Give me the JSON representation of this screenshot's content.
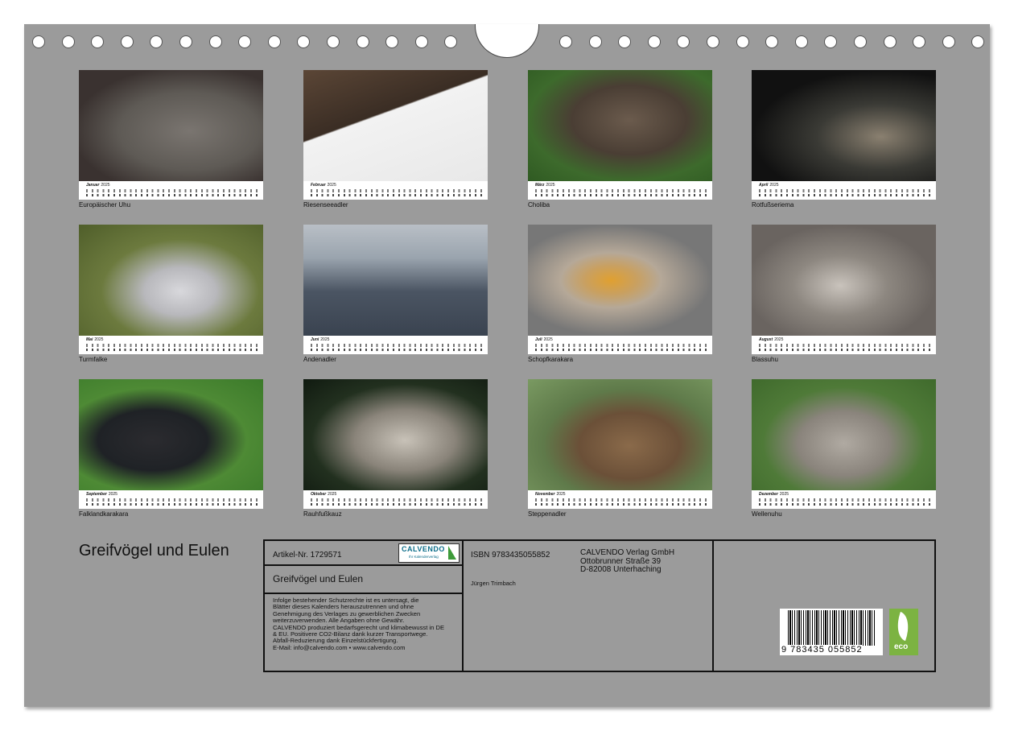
{
  "months": [
    {
      "month": "Januar",
      "year": "2025",
      "caption": "Europäischer Uhu"
    },
    {
      "month": "Februar",
      "year": "2025",
      "caption": "Riesenseeadler"
    },
    {
      "month": "März",
      "year": "2025",
      "caption": "Choliba"
    },
    {
      "month": "April",
      "year": "2025",
      "caption": "Rotfußseriema"
    },
    {
      "month": "Mai",
      "year": "2025",
      "caption": "Turmfalke"
    },
    {
      "month": "Juni",
      "year": "2025",
      "caption": "Andenadler"
    },
    {
      "month": "Juli",
      "year": "2025",
      "caption": "Schopfkarakara"
    },
    {
      "month": "August",
      "year": "2025",
      "caption": "Blassuhu"
    },
    {
      "month": "September",
      "year": "2025",
      "caption": "Falklandkarakara"
    },
    {
      "month": "Oktober",
      "year": "2025",
      "caption": "Rauhfußkauz"
    },
    {
      "month": "November",
      "year": "2025",
      "caption": "Steppenadler"
    },
    {
      "month": "Dezember",
      "year": "2025",
      "caption": "Wellenuhu"
    }
  ],
  "title": "Greifvögel und Eulen",
  "info": {
    "article": "Artikel-Nr. 1729571",
    "product_title": "Greifvögel und Eulen",
    "logo_text": "CALVENDO",
    "logo_sub": "Ihr Kalenderverlag",
    "legal": [
      "Infolge bestehender Schutzrechte ist es untersagt, die",
      "Blätter dieses Kalenders herauszutrennen und ohne",
      "Genehmigung des Verlages zu gewerblichen Zwecken",
      "weiterzuverwenden. Alle Angaben ohne Gewähr.",
      "CALVENDO produziert bedarfsgerecht und klimabewusst in DE",
      "& EU. Positivere CO2-Bilanz dank kurzer Transportwege.",
      "Abfall-Reduzierung dank Einzelstückfertigung.",
      "E-Mail: info@calvendo.com • www.calvendo.com"
    ],
    "isbn": "ISBN 9783435055852",
    "author": "Jürgen Trimbach",
    "publisher": [
      "CALVENDO Verlag GmbH",
      "Ottobrunner Straße 39",
      "D-82008 Unterhaching"
    ],
    "barcode_number": "9 783435 055852",
    "eco_label": "eco"
  }
}
